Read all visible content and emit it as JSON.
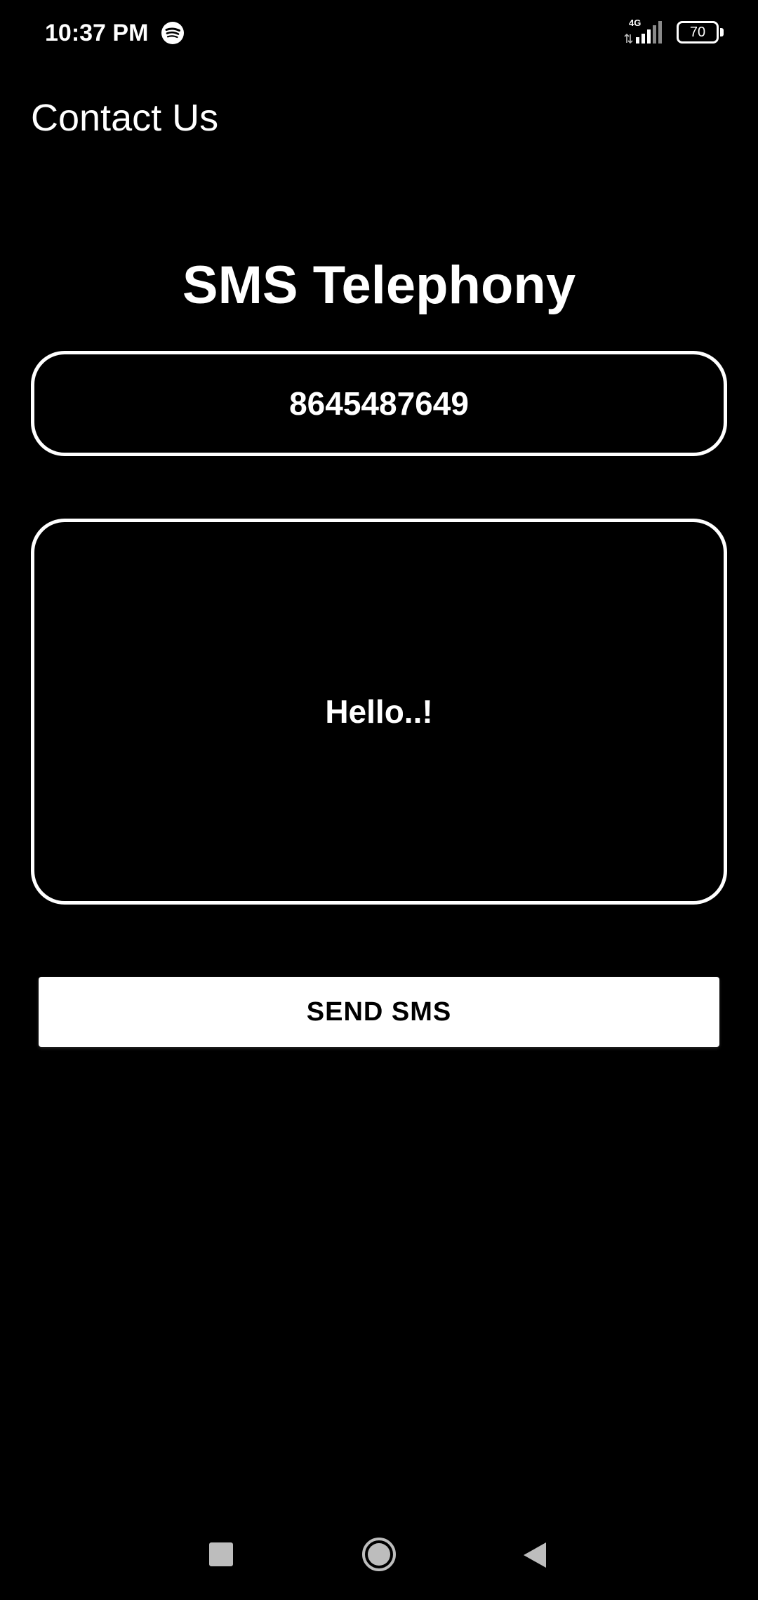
{
  "status_bar": {
    "time": "10:37 PM",
    "network_type": "4G",
    "battery_level": "70",
    "icons": [
      "spotify-icon",
      "signal-icon",
      "battery-icon"
    ]
  },
  "app_bar": {
    "title": "Contact Us"
  },
  "main": {
    "heading": "SMS Telephony",
    "phone_field": {
      "value": "8645487649"
    },
    "message_field": {
      "value": "Hello..!"
    },
    "send_button_label": "SEND SMS"
  },
  "nav_bar": {
    "icons": [
      "recents-icon",
      "home-icon",
      "back-icon"
    ]
  },
  "colors": {
    "background": "#000000",
    "foreground": "#ffffff",
    "button_text": "#000000",
    "nav_icon": "#bdbdbd"
  }
}
